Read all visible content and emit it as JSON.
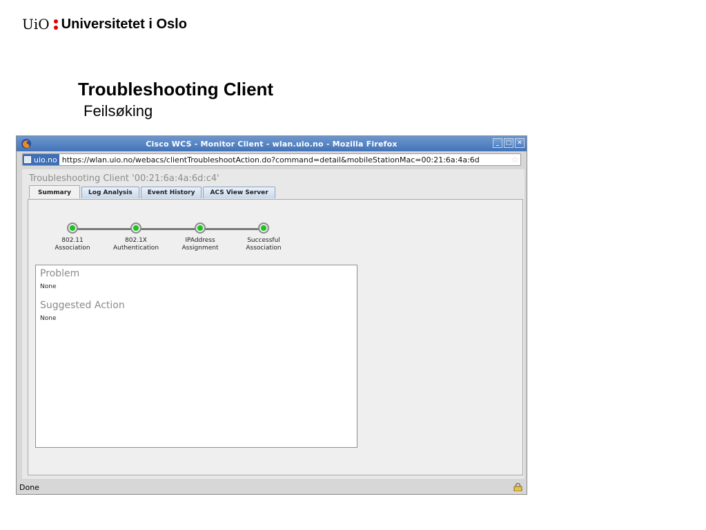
{
  "slide": {
    "logo_abbr": "UiO",
    "logo_name": "Universitetet i Oslo",
    "title": "Troubleshooting Client",
    "subtitle": "Feilsøking"
  },
  "browser": {
    "window_title": "Cisco WCS - Monitor Client - wlan.uio.no - Mozilla Firefox",
    "site_badge": "uio.no",
    "url": "https://wlan.uio.no/webacs/clientTroubleshootAction.do?command=detail&mobileStationMac=00:21:6a:4a:6d",
    "status": "Done",
    "window_buttons": [
      "_",
      "□",
      "✕"
    ],
    "accent_color": "#4474b8"
  },
  "page": {
    "heading": "Troubleshooting Client '00:21:6a:4a:6d:c4'",
    "tabs": [
      {
        "label": "Summary",
        "active": true
      },
      {
        "label": "Log Analysis",
        "active": false
      },
      {
        "label": "Event History",
        "active": false
      },
      {
        "label": "ACS View Server",
        "active": false
      }
    ],
    "steps": [
      {
        "line1": "802.11",
        "line2": "Association",
        "status": "ok"
      },
      {
        "line1": "802.1X",
        "line2": "Authentication",
        "status": "ok"
      },
      {
        "line1": "IPAddress",
        "line2": "Assignment",
        "status": "ok"
      },
      {
        "line1": "Successful",
        "line2": "Association",
        "status": "ok"
      }
    ],
    "status_color": "#19c51a",
    "problem_heading": "Problem",
    "problem_text": "None",
    "action_heading": "Suggested Action",
    "action_text": "None"
  }
}
